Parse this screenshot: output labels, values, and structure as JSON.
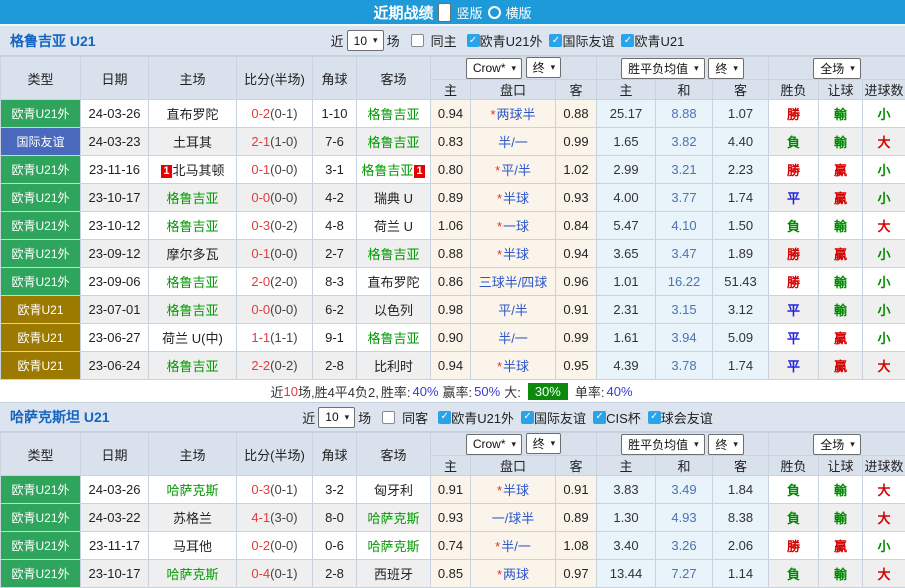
{
  "colors": {
    "topbar_bg": "#1f9ad8",
    "section_title": "#1565c0",
    "focus_team_green": "#009900",
    "score_red": "#e23b3b",
    "handicap_blue": "#2d57c8",
    "big_badge_bg": "#0b8a0b",
    "league_colors": {
      "欧青U21外": "#2ea45c",
      "国际友谊": "#4a69bd",
      "欧青U21": "#9c7a00"
    }
  },
  "icons": {
    "chevron_down": "▾",
    "check": "✓"
  },
  "header_bar": {
    "title": "近期战绩",
    "options": [
      {
        "label": "竖版",
        "selected": true
      },
      {
        "label": "横版",
        "selected": false
      }
    ]
  },
  "columns": {
    "type": "类型",
    "date": "日期",
    "home": "主场",
    "score": "比分(半场)",
    "corner": "角球",
    "away": "客场",
    "odds_home": "主",
    "handicap": "盘口",
    "odds_away": "客",
    "avg_home": "主",
    "avg_draw": "和",
    "avg_away": "客",
    "result": "胜负",
    "handicap_result": "让球",
    "goals": "进球数"
  },
  "dropdowns": {
    "company": "Crow*",
    "final": "终",
    "avg": "胜平负均值",
    "fulltime": "全场"
  },
  "sections": [
    {
      "team": "格鲁吉亚 U21",
      "filter": {
        "near_label": "近",
        "count": "10",
        "matches_label": "场",
        "same_label": "同主",
        "same_checked": false,
        "leagues": [
          "欧青U21外",
          "国际友谊",
          "欧青U21"
        ]
      },
      "rows": [
        {
          "league": "欧青U21外",
          "date": "24-03-26",
          "home": "直布罗陀",
          "home_focus": false,
          "home_badge": "",
          "score": "0-2",
          "half": "(0-1)",
          "corner": "1-10",
          "away": "格鲁吉亚",
          "away_focus": true,
          "away_badge": "",
          "odds_home": "0.94",
          "handicap": "两球半",
          "handicap_star": true,
          "odds_away": "0.88",
          "avg_home": "25.17",
          "avg_draw": "8.88",
          "avg_away": "1.07",
          "result": "勝",
          "handicap_result": "輸",
          "goals": "小"
        },
        {
          "league": "国际友谊",
          "date": "24-03-23",
          "home": "土耳其",
          "home_focus": false,
          "home_badge": "",
          "score": "2-1",
          "half": "(1-0)",
          "corner": "7-6",
          "away": "格鲁吉亚",
          "away_focus": true,
          "away_badge": "",
          "odds_home": "0.83",
          "handicap": "半/一",
          "handicap_star": false,
          "odds_away": "0.99",
          "avg_home": "1.65",
          "avg_draw": "3.82",
          "avg_away": "4.40",
          "result": "負",
          "handicap_result": "輸",
          "goals": "大"
        },
        {
          "league": "欧青U21外",
          "date": "23-11-16",
          "home": "北马其顿",
          "home_focus": false,
          "home_badge": "1",
          "score": "0-1",
          "half": "(0-0)",
          "corner": "3-1",
          "away": "格鲁吉亚",
          "away_focus": true,
          "away_badge": "1",
          "odds_home": "0.80",
          "handicap": "平/半",
          "handicap_star": true,
          "odds_away": "1.02",
          "avg_home": "2.99",
          "avg_draw": "3.21",
          "avg_away": "2.23",
          "result": "勝",
          "handicap_result": "贏",
          "goals": "小"
        },
        {
          "league": "欧青U21外",
          "date": "23-10-17",
          "home": "格鲁吉亚",
          "home_focus": true,
          "home_badge": "",
          "score": "0-0",
          "half": "(0-0)",
          "corner": "4-2",
          "away": "瑞典 U",
          "away_focus": false,
          "away_badge": "",
          "odds_home": "0.89",
          "handicap": "半球",
          "handicap_star": true,
          "odds_away": "0.93",
          "avg_home": "4.00",
          "avg_draw": "3.77",
          "avg_away": "1.74",
          "result": "平",
          "handicap_result": "贏",
          "goals": "小"
        },
        {
          "league": "欧青U21外",
          "date": "23-10-12",
          "home": "格鲁吉亚",
          "home_focus": true,
          "home_badge": "",
          "score": "0-3",
          "half": "(0-2)",
          "corner": "4-8",
          "away": "荷兰 U",
          "away_focus": false,
          "away_badge": "",
          "odds_home": "1.06",
          "handicap": "一球",
          "handicap_star": true,
          "odds_away": "0.84",
          "avg_home": "5.47",
          "avg_draw": "4.10",
          "avg_away": "1.50",
          "result": "負",
          "handicap_result": "輸",
          "goals": "大"
        },
        {
          "league": "欧青U21外",
          "date": "23-09-12",
          "home": "摩尔多瓦",
          "home_focus": false,
          "home_badge": "",
          "score": "0-1",
          "half": "(0-0)",
          "corner": "2-7",
          "away": "格鲁吉亚",
          "away_focus": true,
          "away_badge": "",
          "odds_home": "0.88",
          "handicap": "半球",
          "handicap_star": true,
          "odds_away": "0.94",
          "avg_home": "3.65",
          "avg_draw": "3.47",
          "avg_away": "1.89",
          "result": "勝",
          "handicap_result": "贏",
          "goals": "小"
        },
        {
          "league": "欧青U21外",
          "date": "23-09-06",
          "home": "格鲁吉亚",
          "home_focus": true,
          "home_badge": "",
          "score": "2-0",
          "half": "(2-0)",
          "corner": "8-3",
          "away": "直布罗陀",
          "away_focus": false,
          "away_badge": "",
          "odds_home": "0.86",
          "handicap": "三球半/四球",
          "handicap_star": false,
          "odds_away": "0.96",
          "avg_home": "1.01",
          "avg_draw": "16.22",
          "avg_away": "51.43",
          "result": "勝",
          "handicap_result": "輸",
          "goals": "小"
        },
        {
          "league": "欧青U21",
          "date": "23-07-01",
          "home": "格鲁吉亚",
          "home_focus": true,
          "home_badge": "",
          "score": "0-0",
          "half": "(0-0)",
          "corner": "6-2",
          "away": "以色列",
          "away_focus": false,
          "away_badge": "",
          "odds_home": "0.98",
          "handicap": "平/半",
          "handicap_star": false,
          "odds_away": "0.91",
          "avg_home": "2.31",
          "avg_draw": "3.15",
          "avg_away": "3.12",
          "result": "平",
          "handicap_result": "輸",
          "goals": "小"
        },
        {
          "league": "欧青U21",
          "date": "23-06-27",
          "home": "荷兰 U(中)",
          "home_focus": false,
          "home_badge": "",
          "score": "1-1",
          "half": "(1-1)",
          "corner": "9-1",
          "away": "格鲁吉亚",
          "away_focus": true,
          "away_badge": "",
          "odds_home": "0.90",
          "handicap": "半/一",
          "handicap_star": false,
          "odds_away": "0.99",
          "avg_home": "1.61",
          "avg_draw": "3.94",
          "avg_away": "5.09",
          "result": "平",
          "handicap_result": "贏",
          "goals": "小"
        },
        {
          "league": "欧青U21",
          "date": "23-06-24",
          "home": "格鲁吉亚",
          "home_focus": true,
          "home_badge": "",
          "score": "2-2",
          "half": "(0-2)",
          "corner": "2-8",
          "away": "比利时",
          "away_focus": false,
          "away_badge": "",
          "odds_home": "0.94",
          "handicap": "半球",
          "handicap_star": true,
          "odds_away": "0.95",
          "avg_home": "4.39",
          "avg_draw": "3.78",
          "avg_away": "1.74",
          "result": "平",
          "handicap_result": "贏",
          "goals": "大"
        }
      ],
      "summary": {
        "prefix": "近",
        "count": "10",
        "record": "场,胜4平4负2,",
        "win_rate_label": "胜率:",
        "win_rate": "40%",
        "profit_label": "赢率:",
        "profit_rate": "50%",
        "big_label": "大:",
        "big_rate": "30%",
        "single_label": "单率:",
        "single_rate": "40%"
      }
    },
    {
      "team": "哈萨克斯坦 U21",
      "filter": {
        "near_label": "近",
        "count": "10",
        "matches_label": "场",
        "same_label": "同客",
        "same_checked": false,
        "leagues": [
          "欧青U21外",
          "国际友谊",
          "CIS杯",
          "球会友谊"
        ]
      },
      "rows": [
        {
          "league": "欧青U21外",
          "date": "24-03-26",
          "home": "哈萨克斯",
          "home_focus": true,
          "home_badge": "",
          "score": "0-3",
          "half": "(0-1)",
          "corner": "3-2",
          "away": "匈牙利",
          "away_focus": false,
          "away_badge": "",
          "odds_home": "0.91",
          "handicap": "半球",
          "handicap_star": true,
          "odds_away": "0.91",
          "avg_home": "3.83",
          "avg_draw": "3.49",
          "avg_away": "1.84",
          "result": "負",
          "handicap_result": "輸",
          "goals": "大"
        },
        {
          "league": "欧青U21外",
          "date": "24-03-22",
          "home": "苏格兰",
          "home_focus": false,
          "home_badge": "",
          "score": "4-1",
          "half": "(3-0)",
          "corner": "8-0",
          "away": "哈萨克斯",
          "away_focus": true,
          "away_badge": "",
          "odds_home": "0.93",
          "handicap": "一/球半",
          "handicap_star": false,
          "odds_away": "0.89",
          "avg_home": "1.30",
          "avg_draw": "4.93",
          "avg_away": "8.38",
          "result": "負",
          "handicap_result": "輸",
          "goals": "大"
        },
        {
          "league": "欧青U21外",
          "date": "23-11-17",
          "home": "马耳他",
          "home_focus": false,
          "home_badge": "",
          "score": "0-2",
          "half": "(0-0)",
          "corner": "0-6",
          "away": "哈萨克斯",
          "away_focus": true,
          "away_badge": "",
          "odds_home": "0.74",
          "handicap": "半/一",
          "handicap_star": true,
          "odds_away": "1.08",
          "avg_home": "3.40",
          "avg_draw": "3.26",
          "avg_away": "2.06",
          "result": "勝",
          "handicap_result": "贏",
          "goals": "小"
        },
        {
          "league": "欧青U21外",
          "date": "23-10-17",
          "home": "哈萨克斯",
          "home_focus": true,
          "home_badge": "",
          "score": "0-4",
          "half": "(0-1)",
          "corner": "2-8",
          "away": "西班牙",
          "away_focus": false,
          "away_badge": "",
          "odds_home": "0.85",
          "handicap": "两球",
          "handicap_star": true,
          "odds_away": "0.97",
          "avg_home": "13.44",
          "avg_draw": "7.27",
          "avg_away": "1.14",
          "result": "負",
          "handicap_result": "輸",
          "goals": "大"
        }
      ]
    }
  ]
}
